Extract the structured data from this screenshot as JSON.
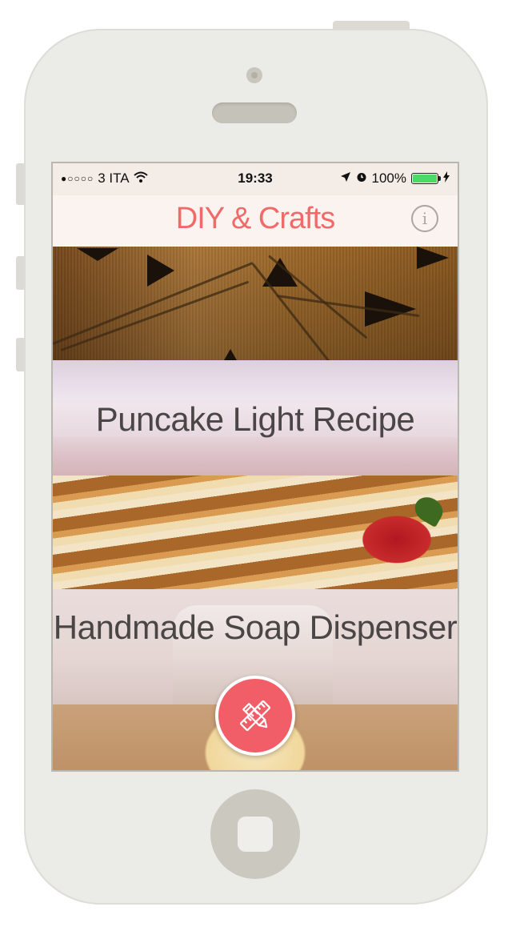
{
  "status_bar": {
    "signal": "●○○○○",
    "carrier": "3 ITA",
    "time": "19:33",
    "battery": "100%"
  },
  "nav": {
    "title": "DIY & Crafts",
    "info_glyph": "i",
    "info_icon": "info-circle-icon"
  },
  "cards": [
    {
      "title": ""
    },
    {
      "title": "Puncake Light Recipe"
    },
    {
      "title": ""
    },
    {
      "title": "Handmade Soap Dispenser"
    }
  ],
  "fab": {
    "icon": "pencil-ruler-icon"
  },
  "colors": {
    "accent": "#ef6b6b",
    "fab": "#f15e67",
    "battery": "#4cd964",
    "phone_shell": "#ebebe7"
  }
}
